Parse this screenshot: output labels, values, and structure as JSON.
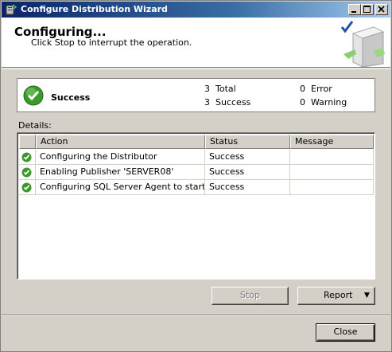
{
  "window": {
    "title": "Configure Distribution Wizard",
    "icon": "wizard-app-icon",
    "controls": {
      "minimize": "_",
      "maximize": "□",
      "close": "×"
    }
  },
  "header": {
    "title": "Configuring...",
    "subtitle": "Click Stop to interrupt the operation.",
    "graphic": "server-checkmark-graphic"
  },
  "summary": {
    "status": "Success",
    "status_icon": "success-check-icon",
    "total_count": "3",
    "total_label": "Total",
    "success_count": "3",
    "success_label": "Success",
    "error_count": "0",
    "error_label": "Error",
    "warning_count": "0",
    "warning_label": "Warning"
  },
  "details": {
    "label": "Details:",
    "columns": [
      "",
      "Action",
      "Status",
      "Message"
    ],
    "rows": [
      {
        "action": "Configuring the Distributor",
        "status": "Success",
        "message": ""
      },
      {
        "action": "Enabling Publisher 'SERVER08'",
        "status": "Success",
        "message": ""
      },
      {
        "action": "Configuring SQL Server Agent to start a...",
        "status": "Success",
        "message": ""
      }
    ]
  },
  "buttons": {
    "stop": "Stop",
    "report": "Report",
    "close": "Close"
  },
  "colors": {
    "titlebar_start": "#0a246a",
    "titlebar_end": "#a6caf0",
    "dialog_bg": "#d4d0c8",
    "success_green": "#3c9a2c"
  }
}
